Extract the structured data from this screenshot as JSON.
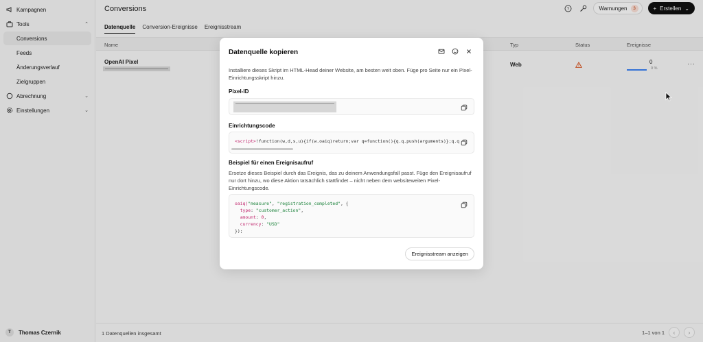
{
  "sidebar": {
    "items": [
      {
        "label": "Kampagnen",
        "icon": "megaphone-icon"
      },
      {
        "label": "Tools",
        "icon": "toolbox-icon"
      },
      {
        "label": "Conversions"
      },
      {
        "label": "Feeds"
      },
      {
        "label": "Änderungsverlauf"
      },
      {
        "label": "Zielgruppen"
      },
      {
        "label": "Abrechnung",
        "icon": "billing-icon"
      },
      {
        "label": "Einstellungen",
        "icon": "gear-icon"
      }
    ],
    "user": {
      "initial": "T",
      "name": "Thomas Czernik"
    }
  },
  "header": {
    "title": "Conversions",
    "warnings_label": "Warnungen",
    "warnings_count": "3",
    "create_label": "Erstellen"
  },
  "tabs": [
    "Datenquelle",
    "Conversion-Ereignisse",
    "Ereignisstream"
  ],
  "table": {
    "columns": [
      "Name",
      "Typ",
      "Status",
      "Ereignisse"
    ],
    "row": {
      "name": "OpenAI Pixel",
      "type": "Web",
      "events": "0",
      "events_pct": "0 %"
    }
  },
  "footer": {
    "total": "1 Datenquellen insgesamt",
    "pagination": "1–1 von 1"
  },
  "modal": {
    "title": "Datenquelle kopieren",
    "description": "Installiere dieses Skript im HTML-Head deiner Website, am besten weit oben. Füge pro Seite nur ein Pixel-Einrichtungsskript hinzu.",
    "pixel_id_label": "Pixel-ID",
    "setup_label": "Einrichtungscode",
    "setup_code_tag": "<script>",
    "setup_code_rest": "!function(w,d,s,u){if(w.oaiq)return;var q=function(){q.q.push(arguments)};q.q",
    "example_label": "Beispiel für einen Ereignisaufruf",
    "example_desc": "Ersetze dieses Beispiel durch das Ereignis, das zu deinem Anwendungsfall passt. Füge den Ereignisaufruf nur dort hinzu, wo diese Aktion tatsächlich stattfindet – nicht neben dem websiteweiten Pixel-Einrichtungscode.",
    "example_code": {
      "fn": "oaiq(",
      "arg1": "\"measure\"",
      "arg2": "\"registration_completed\"",
      "k1": "type",
      "v1": "\"customer_action\"",
      "k2": "amount",
      "v2": "0",
      "k3": "currency",
      "v3": "\"USD\"",
      "close": "});"
    },
    "button_label": "Ereignisstream anzeigen"
  }
}
